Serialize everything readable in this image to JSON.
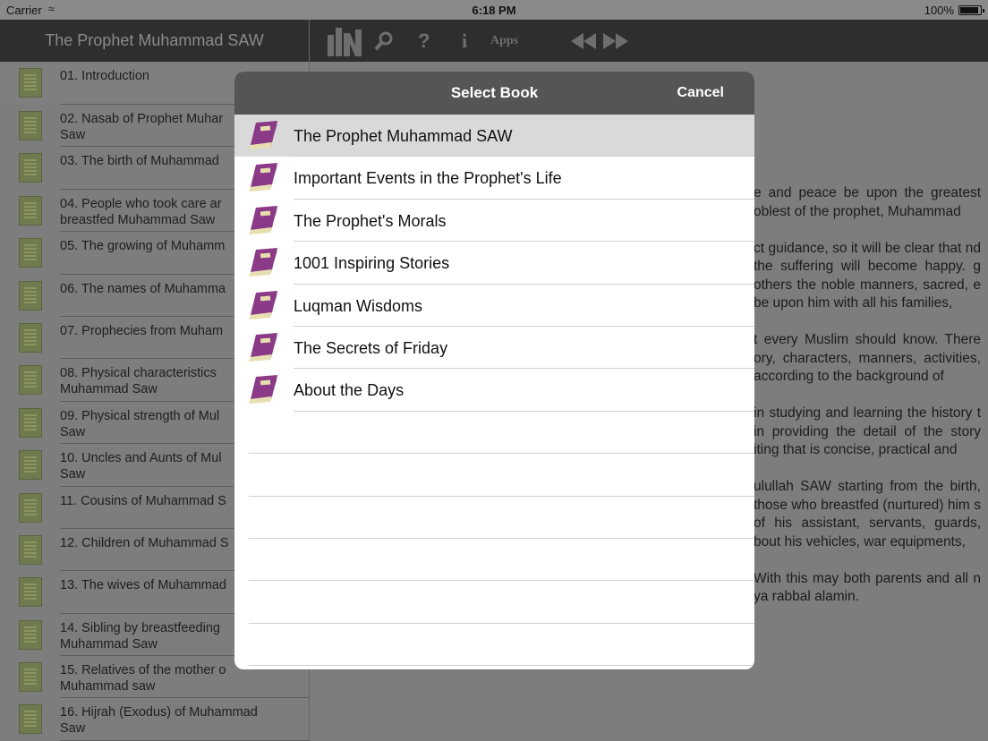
{
  "status_bar": {
    "carrier": "Carrier",
    "time": "6:18 PM",
    "battery": "100%"
  },
  "sidebar": {
    "title": "The Prophet Muhammad SAW",
    "chapters": [
      "01. Introduction",
      "02. Nasab of Prophet Muhar\nSaw",
      "03. The birth of Muhammad",
      "04. People who took care ar\nbreastfed Muhammad Saw",
      "05. The growing of Muhamm",
      "06. The names of Muhamma",
      "07. Prophecies from Muham",
      "08. Physical characteristics\nMuhammad Saw",
      "09. Physical strength of Mul\nSaw",
      "10. Uncles and Aunts of Mul\nSaw",
      "11. Cousins of Muhammad S",
      "12. Children of Muhammad S",
      "13. The wives of Muhammad",
      "14. Sibling by breastfeeding\nMuhammad Saw",
      "15. Relatives of the mother o\nMuhammad saw",
      "16. Hijrah (Exodus) of Muhammad\nSaw"
    ]
  },
  "toolbar": {
    "apps_label": "Apps",
    "icons": [
      "library-icon",
      "search-icon",
      "help-icon",
      "info-icon",
      "previous-icon",
      "next-icon"
    ]
  },
  "content": {
    "paragraphs": [
      "e and peace be upon the greatest oblest of the prophet, Muhammad",
      "ct guidance, so it will be clear that nd the suffering will become happy. g others the noble manners, sacred, e be upon him with all his families,",
      "t every Muslim should know. There ory, characters, manners, activities, according to the background of",
      "in studying and learning the history t in providing the detail of the story iting that is concise, practical and",
      "ulullah SAW starting from the birth, those who breastfed (nurtured) him s of his assistant, servants, guards, bout his vehicles, war equipments,",
      "With this may both parents and all n ya rabbal alamin."
    ]
  },
  "modal": {
    "title": "Select Book",
    "cancel_label": "Cancel",
    "books": [
      "The Prophet Muhammad SAW",
      "Important Events in the Prophet's Life",
      "The Prophet's Morals",
      "1001 Inspiring Stories",
      "Luqman Wisdoms",
      "The Secrets of Friday",
      "About the Days"
    ],
    "selected_index": 0,
    "icon": "book-icon",
    "book_color": "#8a3a86"
  }
}
